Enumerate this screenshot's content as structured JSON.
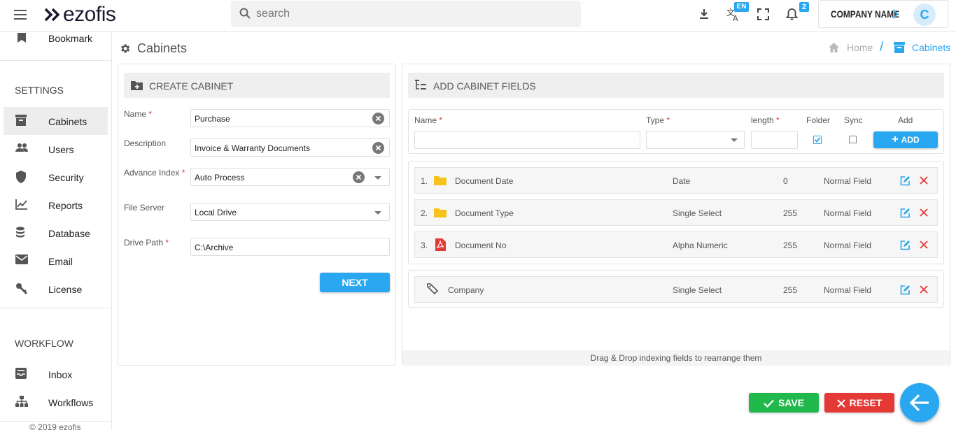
{
  "header": {
    "logo_text": "ezofis",
    "search_placeholder": "search",
    "language_badge": "EN",
    "notification_count": "2",
    "company_name": "COMPANY NAME",
    "avatar_initial": "C"
  },
  "sidebar": {
    "bookmark_label": "Bookmark",
    "settings_heading": "SETTINGS",
    "settings_items": [
      {
        "label": "Cabinets",
        "icon": "cabinet-icon",
        "active": true
      },
      {
        "label": "Users",
        "icon": "users-icon"
      },
      {
        "label": "Security",
        "icon": "shield-icon"
      },
      {
        "label": "Reports",
        "icon": "chart-icon"
      },
      {
        "label": "Database",
        "icon": "database-icon"
      },
      {
        "label": "Email",
        "icon": "mail-icon"
      },
      {
        "label": "License",
        "icon": "key-icon"
      }
    ],
    "workflow_heading": "WORKFLOW",
    "workflow_items": [
      {
        "label": "Inbox",
        "icon": "inbox-icon"
      },
      {
        "label": "Workflows",
        "icon": "workflow-icon"
      }
    ],
    "footer": "© 2019 ezofis"
  },
  "page": {
    "title": "Cabinets",
    "breadcrumb": {
      "home": "Home",
      "separator": "/",
      "current": "Cabinets"
    }
  },
  "create_cabinet": {
    "heading": "CREATE CABINET",
    "name_label": "Name",
    "name_value": "Purchase",
    "description_label": "Description",
    "description_value": "Invoice & Warranty Documents",
    "advance_index_label": "Advance Index",
    "advance_index_value": "Auto Process",
    "file_server_label": "File Server",
    "file_server_value": "Local Drive",
    "drive_path_label": "Drive Path",
    "drive_path_value": "C:\\Archive",
    "next_button": "NEXT",
    "required_mark": "*"
  },
  "add_fields": {
    "heading": "ADD CABINET FIELDS",
    "col_name": "Name",
    "col_type": "Type",
    "col_length": "length",
    "col_folder": "Folder",
    "col_sync": "Sync",
    "col_add": "Add",
    "add_button": "ADD",
    "folder_checked": true,
    "sync_checked": false,
    "rows": [
      {
        "num": "1.",
        "name": "Document Date",
        "type": "Date",
        "length": "0",
        "kind": "Normal Field",
        "icon": "folder-icon"
      },
      {
        "num": "2.",
        "name": "Document Type",
        "type": "Single Select",
        "length": "255",
        "kind": "Normal Field",
        "icon": "folder-icon"
      },
      {
        "num": "3.",
        "name": "Document No",
        "type": "Alpha Numeric",
        "length": "255",
        "kind": "Normal Field",
        "icon": "pdf-icon"
      }
    ],
    "extra_row": {
      "name": "Company",
      "type": "Single Select",
      "length": "255",
      "kind": "Normal Field",
      "icon": "tag-icon"
    },
    "drag_note": "Drag & Drop indexing fields to rearrange them"
  },
  "actions": {
    "save_button": "SAVE",
    "reset_button": "RESET"
  },
  "colors": {
    "accent": "#2aa7f1",
    "save": "#21b94b",
    "reset": "#e53935",
    "folder": "#f7c21b",
    "pdf": "#e53935"
  }
}
